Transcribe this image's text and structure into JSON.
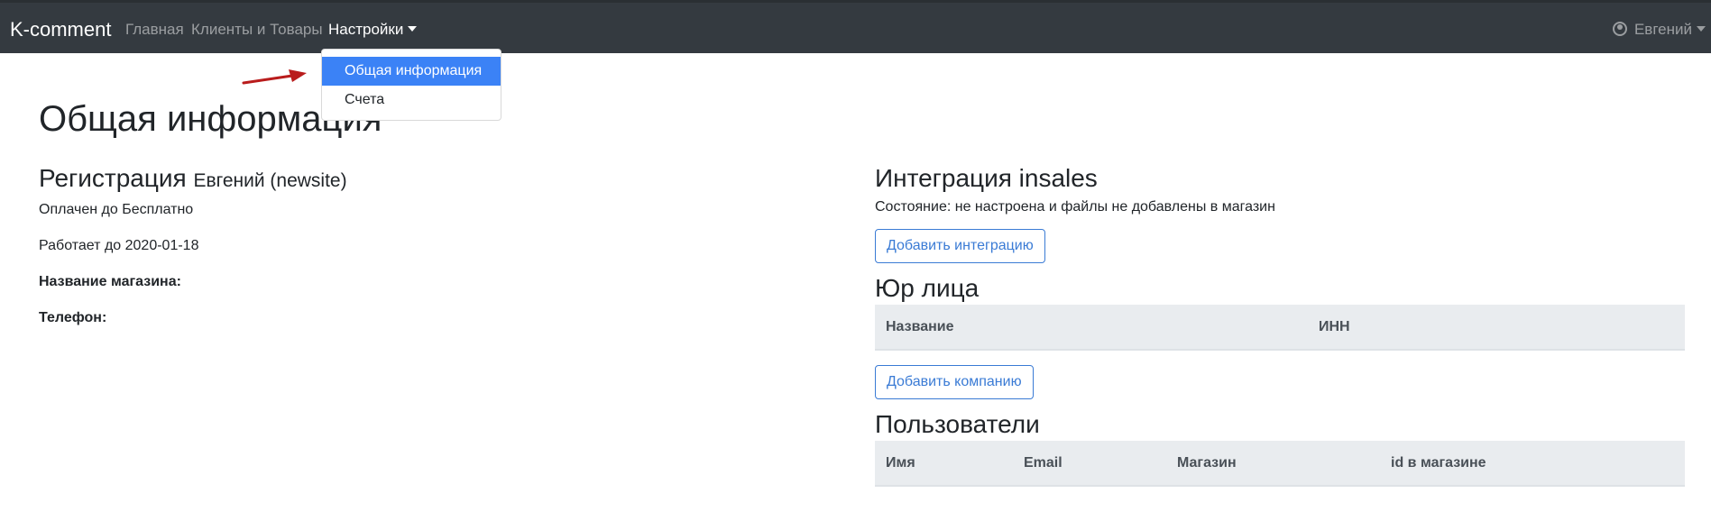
{
  "navbar": {
    "brand": "K-comment",
    "links": [
      "Главная",
      "Клиенты и Товары"
    ],
    "settings_label": "Настройки",
    "user_label": "Евгений"
  },
  "dropdown": {
    "items": [
      "Общая информация",
      "Счета"
    ]
  },
  "page": {
    "title": "Общая информация"
  },
  "registration": {
    "heading": "Регистрация",
    "user": "Евгений (newsite)",
    "paid_until": "Оплачен до Бесплатно",
    "works_until": "Работает до 2020-01-18",
    "shop_name_label": "Название магазина:",
    "phone_label": "Телефон:"
  },
  "integration": {
    "heading": "Интеграция insales",
    "status": "Состояние: не настроена и файлы не добавлены в магазин",
    "add_button": "Добавить интеграцию"
  },
  "legal_entities": {
    "heading": "Юр лица",
    "columns": [
      "Название",
      "ИНН"
    ],
    "add_button": "Добавить компанию"
  },
  "users": {
    "heading": "Пользователи",
    "columns": [
      "Имя",
      "Email",
      "Магазин",
      "id в магазине"
    ]
  },
  "colors": {
    "navbar_bg": "#343a40",
    "accent": "#3b82f6",
    "outline_button": "#3a7bd5",
    "annotation_arrow": "#b91c1c"
  }
}
